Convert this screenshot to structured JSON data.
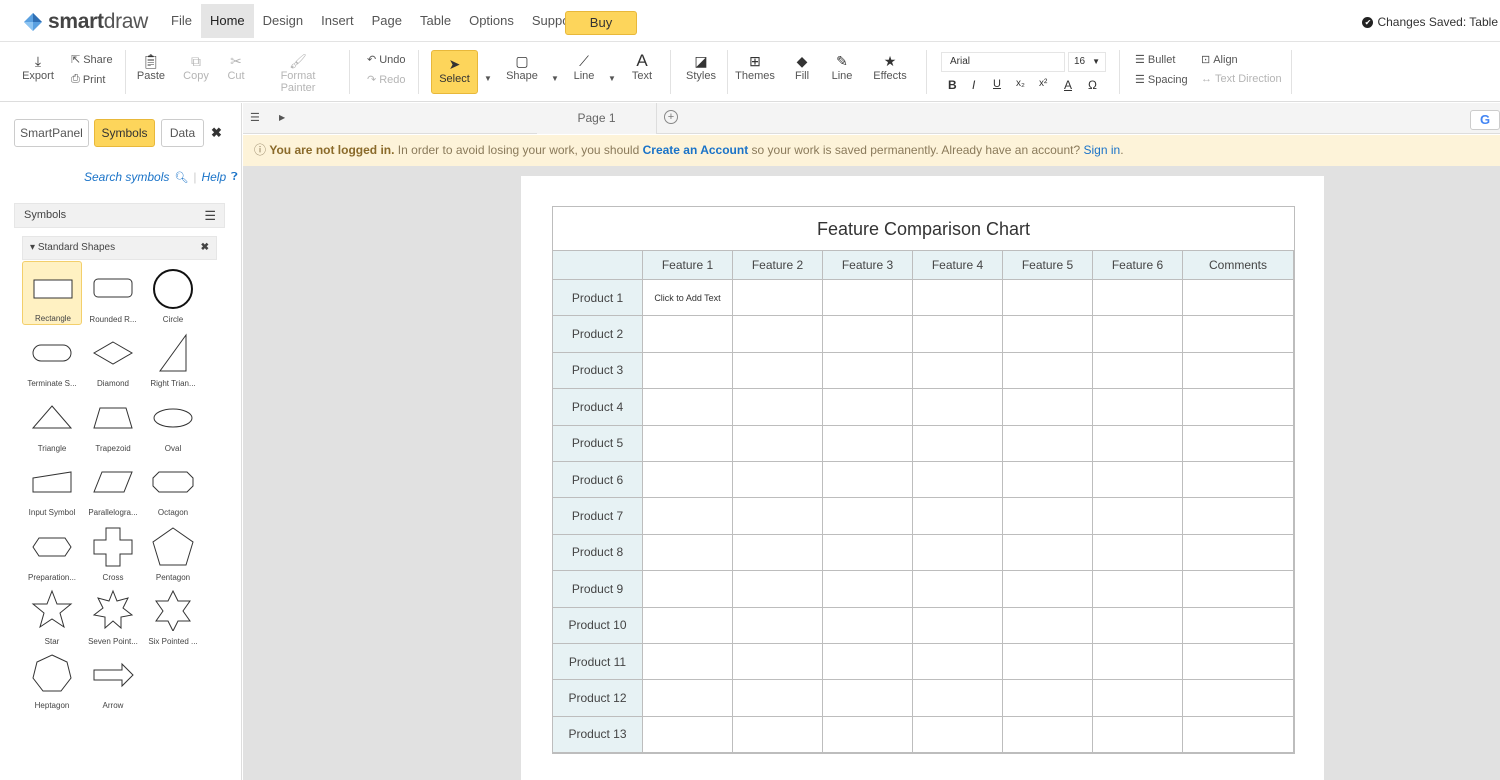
{
  "app": {
    "logo_bold": "smart",
    "logo_light": "draw",
    "menus": [
      "File",
      "Home",
      "Design",
      "Insert",
      "Page",
      "Table",
      "Options",
      "Support"
    ],
    "active_menu": "Home",
    "buy_label": "Buy",
    "saved_status": "Changes Saved: Table"
  },
  "ribbon": {
    "export": "Export",
    "share": "Share",
    "print": "Print",
    "paste": "Paste",
    "copy": "Copy",
    "cut": "Cut",
    "format_painter": "Format Painter",
    "undo": "Undo",
    "redo": "Redo",
    "select": "Select",
    "shape": "Shape",
    "line": "Line",
    "text": "Text",
    "styles": "Styles",
    "themes": "Themes",
    "fill": "Fill",
    "line2": "Line",
    "effects": "Effects",
    "font": "Arial",
    "font_size": "16",
    "bold": "B",
    "italic": "I",
    "underline": "U",
    "subscript": "x₂",
    "superscript": "x²",
    "font_color": "A",
    "omega": "Ω",
    "bullet": "Bullet",
    "align": "Align",
    "spacing": "Spacing",
    "text_direction": "Text Direction"
  },
  "left_panel": {
    "tabs": [
      "SmartPanel",
      "Symbols",
      "Data"
    ],
    "active_tab": "Symbols",
    "search_label": "Search symbols",
    "help_label": "Help",
    "symbols_header": "Symbols",
    "library": "Standard Shapes",
    "shapes": [
      {
        "label": "Rectangle",
        "icon": "rectangle-icon"
      },
      {
        "label": "Rounded R...",
        "icon": "rounded-rectangle-icon"
      },
      {
        "label": "Circle",
        "icon": "circle-icon"
      },
      {
        "label": "Terminate S...",
        "icon": "terminator-icon"
      },
      {
        "label": "Diamond",
        "icon": "diamond-icon"
      },
      {
        "label": "Right Trian...",
        "icon": "right-triangle-icon"
      },
      {
        "label": "Triangle",
        "icon": "triangle-icon"
      },
      {
        "label": "Trapezoid",
        "icon": "trapezoid-icon"
      },
      {
        "label": "Oval",
        "icon": "oval-icon"
      },
      {
        "label": "Input Symbol",
        "icon": "input-symbol-icon"
      },
      {
        "label": "Parallelogra...",
        "icon": "parallelogram-icon"
      },
      {
        "label": "Octagon",
        "icon": "octagon-icon"
      },
      {
        "label": "Preparation...",
        "icon": "preparation-icon"
      },
      {
        "label": "Cross",
        "icon": "cross-icon"
      },
      {
        "label": "Pentagon",
        "icon": "pentagon-icon"
      },
      {
        "label": "Star",
        "icon": "star-icon"
      },
      {
        "label": "Seven Point...",
        "icon": "seven-point-star-icon"
      },
      {
        "label": "Six Pointed ...",
        "icon": "six-point-star-icon"
      },
      {
        "label": "Heptagon",
        "icon": "heptagon-icon"
      },
      {
        "label": "Arrow",
        "icon": "arrow-icon"
      }
    ]
  },
  "page_tabs": {
    "current": "Page 1",
    "google_label": "G"
  },
  "notice": {
    "bold": "You are not logged in.",
    "text1": " In order to avoid losing your work, you should ",
    "link1": "Create an Account",
    "text2": " so your work is saved permanently. Already have an account? ",
    "link2": "Sign in",
    "text3": "."
  },
  "table": {
    "title": "Feature Comparison Chart",
    "columns": [
      "",
      "Feature 1",
      "Feature 2",
      "Feature 3",
      "Feature 4",
      "Feature 5",
      "Feature 6",
      "Comments"
    ],
    "rows": [
      "Product 1",
      "Product 2",
      "Product 3",
      "Product 4",
      "Product 5",
      "Product 6",
      "Product 7",
      "Product 8",
      "Product 9",
      "Product 10",
      "Product 11",
      "Product 12",
      "Product 13"
    ],
    "placeholder": "Click to Add Text"
  },
  "colors": {
    "accent": "#fdd55b",
    "header_fill": "#e7f2f4",
    "notice_bg": "#fdf3d9",
    "link": "#1a73c8"
  }
}
